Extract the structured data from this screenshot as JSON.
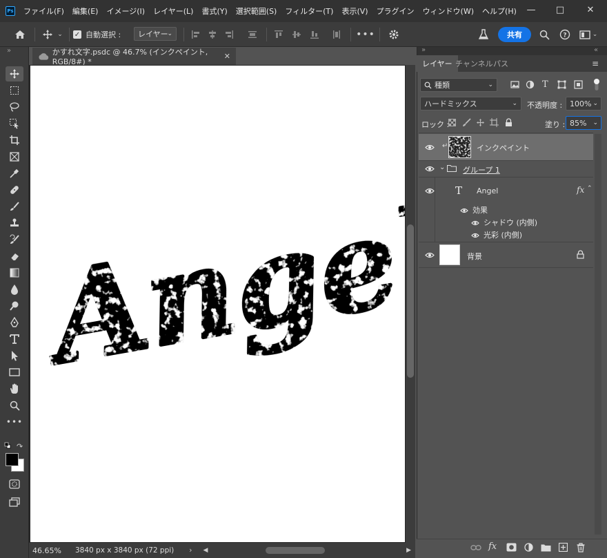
{
  "app": {
    "logo": "Ps"
  },
  "menu": [
    "ファイル(F)",
    "編集(E)",
    "イメージ(I)",
    "レイヤー(L)",
    "書式(Y)",
    "選択範囲(S)",
    "フィルター(T)",
    "表示(V)",
    "プラグイン",
    "ウィンドウ(W)",
    "ヘルプ(H)"
  ],
  "options_bar": {
    "auto_select_label": "自動選択 :",
    "auto_select_checked": true,
    "target_value": "レイヤー",
    "share_label": "共有"
  },
  "document": {
    "tab_title": "かすれ文字.psdc @ 46.7% (インクペイント, RGB/8#) *",
    "zoom": "46.65%",
    "size_info": "3840 px x 3840 px (72 ppi)",
    "canvas_text": "Angel"
  },
  "panel": {
    "tabs": [
      "レイヤー",
      "チャンネル",
      "パス"
    ],
    "filter_value": "種類",
    "blend_mode": "ハードミックス",
    "opacity_label": "不透明度 :",
    "opacity_value": "100%",
    "lock_label": "ロック :",
    "fill_label": "塗り :",
    "fill_value": "85%",
    "layers": [
      {
        "name": "インクペイント",
        "type": "pixel",
        "selected": true
      },
      {
        "name": "グループ 1",
        "type": "group",
        "expanded": true
      },
      {
        "name": "Angel",
        "type": "text",
        "fx": "fx"
      },
      {
        "name": "効果",
        "type": "effects"
      },
      {
        "name": "シャドウ (内側)",
        "type": "effect"
      },
      {
        "name": "光彩 (内側)",
        "type": "effect"
      },
      {
        "name": "背景",
        "type": "background",
        "locked": true
      }
    ]
  },
  "colors": {
    "accent": "#1473e6",
    "panel_bg": "#535353",
    "bar_bg": "#3c3c3c"
  }
}
